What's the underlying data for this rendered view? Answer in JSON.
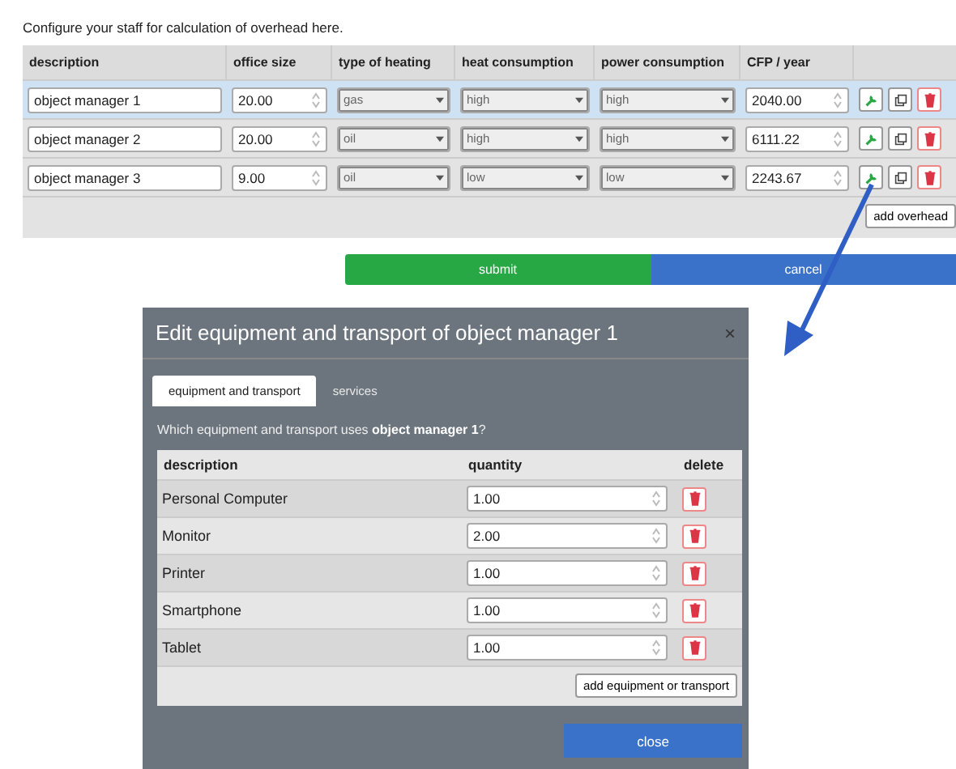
{
  "intro": "Configure your staff for calculation of overhead here.",
  "staff_table": {
    "columns": [
      "description",
      "office size",
      "type of heating",
      "heat consumption",
      "power consumption",
      "CFP / year"
    ],
    "rows": [
      {
        "description": "object manager 1",
        "office_size": "20.00",
        "heating": "gas",
        "heat_consumption": "high",
        "power_consumption": "high",
        "cfp": "2040.00",
        "selected": true
      },
      {
        "description": "object manager 2",
        "office_size": "20.00",
        "heating": "oil",
        "heat_consumption": "high",
        "power_consumption": "high",
        "cfp": "6111.22",
        "selected": false
      },
      {
        "description": "object manager 3",
        "office_size": "9.00",
        "heating": "oil",
        "heat_consumption": "low",
        "power_consumption": "low",
        "cfp": "2243.67",
        "selected": false
      }
    ],
    "add_button": "add overhead"
  },
  "buttons": [
    {
      "label": "submit",
      "kind": "success"
    },
    {
      "label": "cancel",
      "kind": "primary"
    }
  ],
  "dialog": {
    "title": "Edit equipment and transport of object manager 1",
    "close_icon": "×",
    "tabs": [
      {
        "label": "equipment and transport",
        "selected": true
      },
      {
        "label": "services",
        "selected": false
      }
    ],
    "question": "Which equipment and transport uses **object manager 1**?",
    "table": {
      "columns": [
        "description",
        "quantity",
        "delete"
      ],
      "rows": [
        {
          "description": "Personal Computer",
          "quantity": "1.00"
        },
        {
          "description": "Monitor",
          "quantity": "2.00"
        },
        {
          "description": "Printer",
          "quantity": "1.00"
        },
        {
          "description": "Smartphone",
          "quantity": "1.00"
        },
        {
          "description": "Tablet",
          "quantity": "1.00"
        }
      ],
      "add_button": "add equipment or transport"
    },
    "close_button": "close"
  }
}
